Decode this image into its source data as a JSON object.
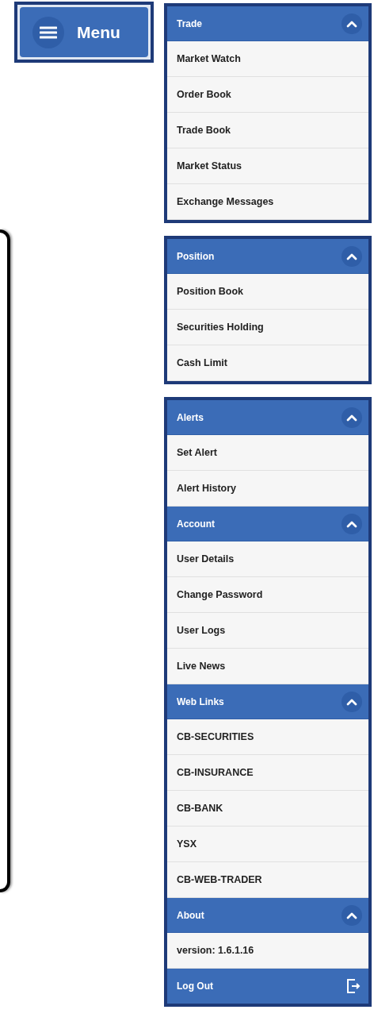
{
  "menu_button": {
    "label": "Menu"
  },
  "panels": [
    {
      "sections": [
        {
          "title": "Trade",
          "expanded": true,
          "items": [
            {
              "label": "Market Watch"
            },
            {
              "label": "Order Book"
            },
            {
              "label": "Trade Book"
            },
            {
              "label": "Market Status"
            },
            {
              "label": "Exchange Messages"
            }
          ]
        }
      ]
    },
    {
      "sections": [
        {
          "title": "Position",
          "expanded": true,
          "items": [
            {
              "label": "Position Book"
            },
            {
              "label": "Securities Holding"
            },
            {
              "label": "Cash Limit"
            }
          ]
        }
      ]
    },
    {
      "sections": [
        {
          "title": "Alerts",
          "expanded": true,
          "items": [
            {
              "label": "Set Alert"
            },
            {
              "label": "Alert History"
            }
          ]
        },
        {
          "title": "Account",
          "expanded": true,
          "items": [
            {
              "label": "User Details"
            },
            {
              "label": "Change Password"
            },
            {
              "label": "User Logs"
            },
            {
              "label": "Live News"
            }
          ]
        },
        {
          "title": "Web Links",
          "expanded": true,
          "items": [
            {
              "label": "CB-SECURITIES"
            },
            {
              "label": "CB-INSURANCE"
            },
            {
              "label": "CB-BANK"
            },
            {
              "label": "YSX"
            },
            {
              "label": "CB-WEB-TRADER"
            }
          ]
        },
        {
          "title": "About",
          "expanded": true,
          "items": [
            {
              "label": "version: 1.6.1.16"
            }
          ]
        }
      ],
      "footer": {
        "label": "Log Out"
      }
    }
  ]
}
